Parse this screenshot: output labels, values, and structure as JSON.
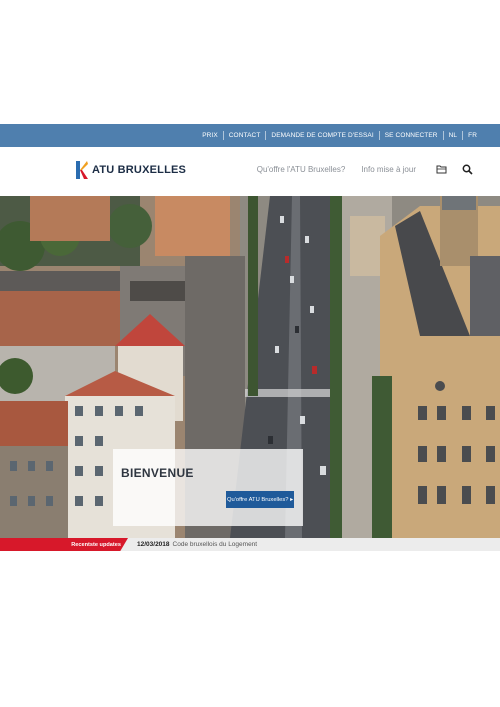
{
  "topbar": {
    "links": [
      "PRIX",
      "CONTACT",
      "DEMANDE DE COMPTE D'ESSAI",
      "SE CONNECTER",
      "NL",
      "FR"
    ]
  },
  "header": {
    "logo_text": "ATU BRUXELLES",
    "nav": {
      "offer_label": "Qu'offre l'ATU Bruxelles?",
      "updates_label": "Info mise à jour"
    },
    "icons": [
      "folder-icon",
      "search-icon"
    ]
  },
  "hero": {
    "title": "BIENVENUE",
    "button_label": "Qu'offre ATU Bruxelles? ▸"
  },
  "ticker": {
    "label": "Recentste updates",
    "date": "12/03/2018",
    "text": "Code bruxellois du Logement"
  },
  "colors": {
    "topbar": "#4f7fae",
    "accent_red": "#d7182a",
    "button_blue": "#1f5a9a",
    "logo_orange": "#f0a020",
    "logo_blue": "#2b6cb0"
  }
}
